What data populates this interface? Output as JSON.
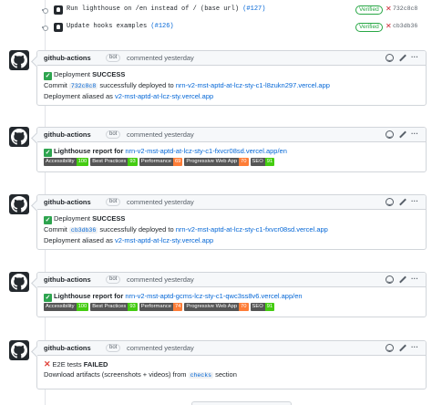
{
  "commits": [
    {
      "message": "Run lighthouse on /en instead of / (base url) ",
      "pr": "(#127)",
      "verified": "Verified",
      "sha": "732c8c8"
    },
    {
      "message": "Update hooks examples ",
      "pr": "(#126)",
      "verified": "Verified",
      "sha": "cb3db36"
    }
  ],
  "comments": [
    {
      "author": "github-actions",
      "bot": "bot",
      "when": "commented yesterday",
      "line1_status": "Deployment ",
      "line1_bold": "SUCCESS",
      "line2_prefix": "Commit ",
      "line2_sha": "732c8c8",
      "line2_mid": " successfully deployed to ",
      "line2_url": "nrn-v2-mst-aptd-at-lcz-sty-c1-l8zukn297.vercel.app",
      "line3_prefix": "Deployment aliased as ",
      "line3_url": "v2-mst-aptd-at-lcz-sty.vercel.app"
    },
    {
      "author": "github-actions",
      "bot": "bot",
      "when": "commented yesterday",
      "prefix": "Lighthouse report for ",
      "url": "nrn-v2-mst-aptd-at-lcz-sty-c1-fxvcr08sd.vercel.app/en",
      "badges": [
        {
          "label": "Accessibility",
          "value": "100",
          "color": "#4c1"
        },
        {
          "label": "Best Practices",
          "value": "93",
          "color": "#4c1"
        },
        {
          "label": "Performance",
          "value": "69",
          "color": "#fe7d37"
        },
        {
          "label": "Progressive Web App",
          "value": "70",
          "color": "#fe7d37"
        },
        {
          "label": "SEO",
          "value": "91",
          "color": "#4c1"
        }
      ]
    },
    {
      "author": "github-actions",
      "bot": "bot",
      "when": "commented yesterday",
      "line1_status": "Deployment ",
      "line1_bold": "SUCCESS",
      "line2_prefix": "Commit ",
      "line2_sha": "cb3db36",
      "line2_mid": " successfully deployed to ",
      "line2_url": "nrn-v2-mst-aptd-at-lcz-sty-c1-fxvcr08sd.vercel.app",
      "line3_prefix": "Deployment aliased as ",
      "line3_url": "v2-mst-aptd-at-lcz-sty.vercel.app"
    },
    {
      "author": "github-actions",
      "bot": "bot",
      "when": "commented yesterday",
      "prefix": "Lighthouse report for ",
      "url": "nrn-v2-mst-aptd-gcms-lcz-sty-c1-qwc3ss8v6.vercel.app/en",
      "badges": [
        {
          "label": "Accessibility",
          "value": "100",
          "color": "#4c1"
        },
        {
          "label": "Best Practices",
          "value": "93",
          "color": "#4c1"
        },
        {
          "label": "Performance",
          "value": "74",
          "color": "#fe7d37"
        },
        {
          "label": "Progressive Web App",
          "value": "70",
          "color": "#fe7d37"
        },
        {
          "label": "SEO",
          "value": "91",
          "color": "#4c1"
        }
      ]
    },
    {
      "author": "github-actions",
      "bot": "bot",
      "when": "commented yesterday",
      "line1_text": "E2E tests ",
      "line1_bold": "FAILED",
      "line2_prefix": "Download artifacts (screenshots + videos) from ",
      "line2_code": "checks",
      "line2_suffix": " section"
    }
  ],
  "colors": {
    "link": "#0366d6",
    "verified": "#28a745",
    "fail": "#cb2431",
    "badge_green": "#4c1",
    "badge_orange": "#fe7d37"
  }
}
